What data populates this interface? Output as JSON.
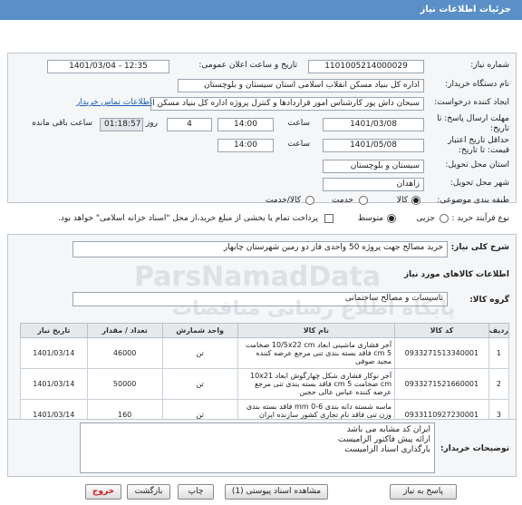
{
  "title": "جزئیات اطلاعات نیاز",
  "fields": {
    "need_number_label": "شماره نیاز:",
    "need_number": "1101005214000029",
    "announce_label": "تاریخ و ساعت اعلان عمومی:",
    "announce_value": "1401/03/04 - 12:35",
    "buyer_label": "نام دستگاه خریدار:",
    "buyer_value": "اداره کل بنیاد مسکن انقلاب اسلامی استان سیستان و بلوچستان",
    "creator_label": "ایجاد کننده درخواست:",
    "creator_value": "سبحان داش پور کارشناس امور قراردادها و کنترل پروژه اداره کل بنیاد مسکن انق",
    "contact_link": "اطلاعات تماس خریدار",
    "deadline_label_1": "مهلت ارسال پاسخ: تا",
    "deadline_label_2": "تاریخ:",
    "deadline_date": "1401/03/08",
    "time_label": "ساعت",
    "deadline_time": "14:00",
    "days_value": "4",
    "days_label": "روز و",
    "remaining_time": "01:18:57",
    "remaining_label": "ساعت باقی مانده",
    "validity_label_1": "حداقل تاریخ اعتبار",
    "validity_label_2": "قیمت: تا تاریخ:",
    "validity_date": "1401/05/08",
    "validity_time_label": "ساعت",
    "validity_time": "14:00",
    "province_label": "استان محل تحویل:",
    "province_value": "سیستان و بلوچستان",
    "city_label": "شهر محل تحویل:",
    "city_value": "زاهدان",
    "category_label": "طبقه بندی موضوعی:",
    "category_options": [
      "کالا",
      "خدمت",
      "کالا/خدمت"
    ],
    "process_label": "نوع فرآیند خرید :",
    "process_options": [
      "جزیی",
      "متوسط"
    ],
    "payment_note": "پرداخت تمام یا بخشی از مبلغ خرید،از محل \"اسناد خزانه اسلامی\" خواهد بود."
  },
  "description_label": "شرح کلی نیاز:",
  "description_value": "خرید مصالح جهت پروژه 50 واحدی فاز دو رمین شهرستان چابهار",
  "goods_info_label": "اطلاعات کالاهای مورد نیاز",
  "goods_group_label": "گروه کالا:",
  "goods_group_value": "تاسیسات و مصالح ساختمانی",
  "table": {
    "headers": [
      "ردیف",
      "کد کالا",
      "نام کالا",
      "واحد شمارش",
      "تعداد / مقدار",
      "تاریخ نیاز"
    ],
    "rows": [
      {
        "row": "1",
        "code": "0933271513340001",
        "name": "آجر فشاری ماشینی ابعاد 10/5x22 cm ضخامت 5 cm فاقد بسته بندی تنی مرجع عرضه کننده مجید صوفی",
        "unit": "تن",
        "qty": "46000",
        "date": "1401/03/14"
      },
      {
        "row": "2",
        "code": "0933271521660001",
        "name": "آجر نوکار فشاری شکل چهارگوش ابعاد 10x21 cm ضخامت 5 cm فاقد بسته بندی تنی مرجع عرضه کننده عباس عالی حجین",
        "unit": "تن",
        "qty": "50000",
        "date": "1401/03/14"
      },
      {
        "row": "3",
        "code": "0933110927230001",
        "name": "ماسه شسته دانه بندی 6-0 mm فاقد بسته بندی وزن تنی فاقد نام تجاری کشور سازنده ایران مرجع عرضه کننده بهزاد زلقی",
        "unit": "تن",
        "qty": "160",
        "date": "1401/03/14"
      }
    ]
  },
  "notes_label": "توضیحات خریدار:",
  "notes_lines": [
    "ایران کد مشابه می باشد",
    "ارائه پیش فاکتور الزامیست",
    "بارگذاری اسناد الزامیست"
  ],
  "buttons": {
    "reply": "پاسخ به نیاز",
    "attachments": "مشاهده اسناد پیوستی (1)",
    "print": "چاپ",
    "back": "بازگشت",
    "exit": "خروج"
  },
  "watermark": "ParsNamadData",
  "watermark_fa": "پایگاه اطلاع رسانی مناقصات",
  "colors": {
    "titlebar": "#5a8fc8",
    "link": "#1a5fb4",
    "exit": "#c41e1e"
  }
}
